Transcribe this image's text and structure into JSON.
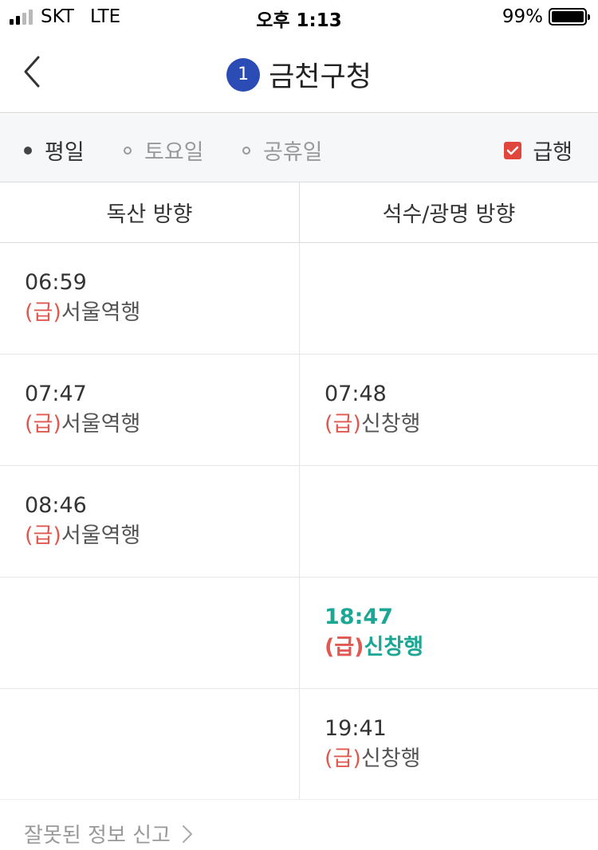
{
  "status_bar": {
    "carrier": "SKT",
    "network": "LTE",
    "time": "오후 1:13",
    "battery": "99%"
  },
  "header": {
    "line_number": "1",
    "line_color": "#2b4bb5",
    "title": "금천구청"
  },
  "filters": {
    "days": [
      {
        "label": "평일",
        "selected": true
      },
      {
        "label": "토요일",
        "selected": false
      },
      {
        "label": "공휴일",
        "selected": false
      }
    ],
    "express_label": "급행",
    "express_checked": true
  },
  "directions": [
    "독산 방향",
    "석수/광명 방향"
  ],
  "express_prefix": "(급)",
  "rows": [
    {
      "left": {
        "time": "06:59",
        "dest": "서울역행"
      },
      "right": null
    },
    {
      "left": {
        "time": "07:47",
        "dest": "서울역행"
      },
      "right": {
        "time": "07:48",
        "dest": "신창행"
      }
    },
    {
      "left": {
        "time": "08:46",
        "dest": "서울역행"
      },
      "right": null
    },
    {
      "left": null,
      "right": {
        "time": "18:47",
        "dest": "신창행",
        "highlight": true
      }
    },
    {
      "left": null,
      "right": {
        "time": "19:41",
        "dest": "신창행"
      }
    }
  ],
  "footer": {
    "report_label": "잘못된 정보 신고"
  },
  "colors": {
    "express": "#e0584f",
    "highlight": "#1ba794",
    "checkbox": "#e0463c"
  }
}
